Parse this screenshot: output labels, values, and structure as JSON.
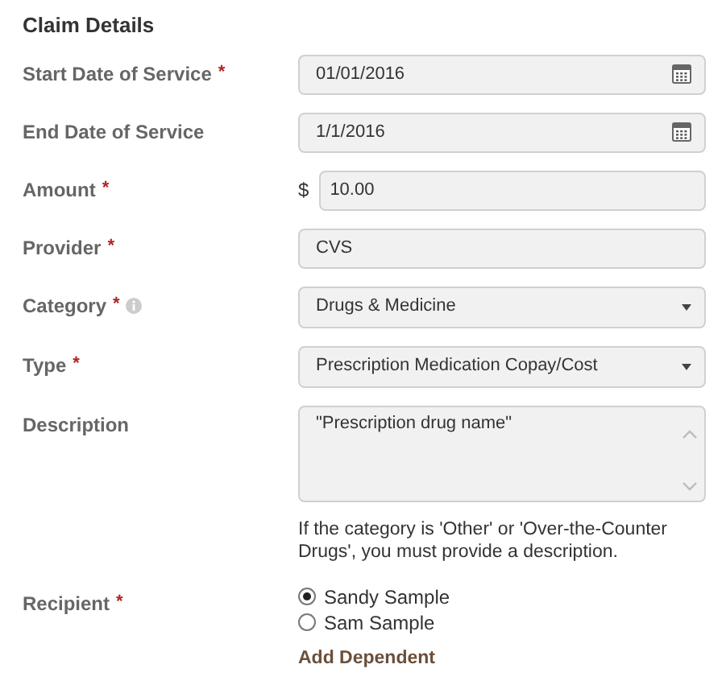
{
  "section_title": "Claim Details",
  "fields": [
    {
      "label": "Start Date of Service",
      "required_mark": "*",
      "info": false,
      "kind": "date",
      "value": "01/01/2016"
    },
    {
      "label": "End Date of Service",
      "info": false,
      "kind": "date",
      "value": "1/1/2016"
    },
    {
      "label": "Amount",
      "required_mark": "*",
      "info": false,
      "kind": "currency",
      "prefix": "$",
      "value": "10.00"
    },
    {
      "label": "Provider",
      "required_mark": "*",
      "info": false,
      "kind": "text",
      "value": "CVS"
    },
    {
      "label": "Category",
      "required_mark": "*",
      "info": true,
      "kind": "select",
      "value": "Drugs & Medicine"
    },
    {
      "label": "Type",
      "required_mark": "*",
      "info": false,
      "kind": "select",
      "value": "Prescription Medication Copay/Cost"
    },
    {
      "label": "Description",
      "info": false,
      "kind": "textarea",
      "value": "\"Prescription drug name\"",
      "help": "If the category is 'Other' or 'Over-the-Counter Drugs', you must provide a description."
    }
  ],
  "recipient": {
    "label": "Recipient",
    "required_mark": "*",
    "options": [
      {
        "label": "Sandy Sample",
        "selected": true
      },
      {
        "label": "Sam Sample",
        "selected": false
      }
    ],
    "link": "Add Dependent"
  }
}
